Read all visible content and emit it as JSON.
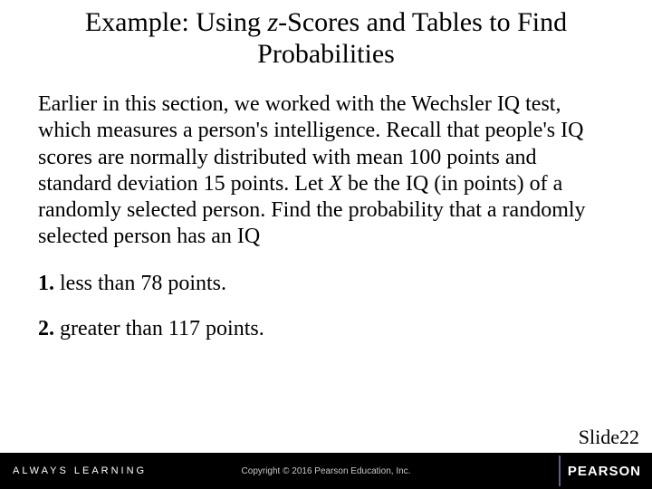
{
  "title": {
    "pre": "Example: Using ",
    "z": "z",
    "post": "-Scores and Tables to Find Probabilities"
  },
  "body": {
    "pre": "Earlier in this section, we worked with the Wechsler IQ test, which measures a person's intelligence. Recall that people's IQ scores are normally distributed with mean 100 points and standard deviation 15 points. Let ",
    "X": "X",
    "post": " be the IQ (in points) of a randomly selected person. Find the probability that a randomly selected person has an IQ"
  },
  "items": [
    {
      "num": "1.",
      "text": " less than 78 points."
    },
    {
      "num": "2.",
      "text": " greater than 117 points."
    }
  ],
  "footer": {
    "always": "ALWAYS LEARNING",
    "copyright": "Copyright © 2016 Pearson Education, Inc.",
    "brand": "PEARSON",
    "slide_label": "Slide ",
    "slide_num": "22"
  }
}
